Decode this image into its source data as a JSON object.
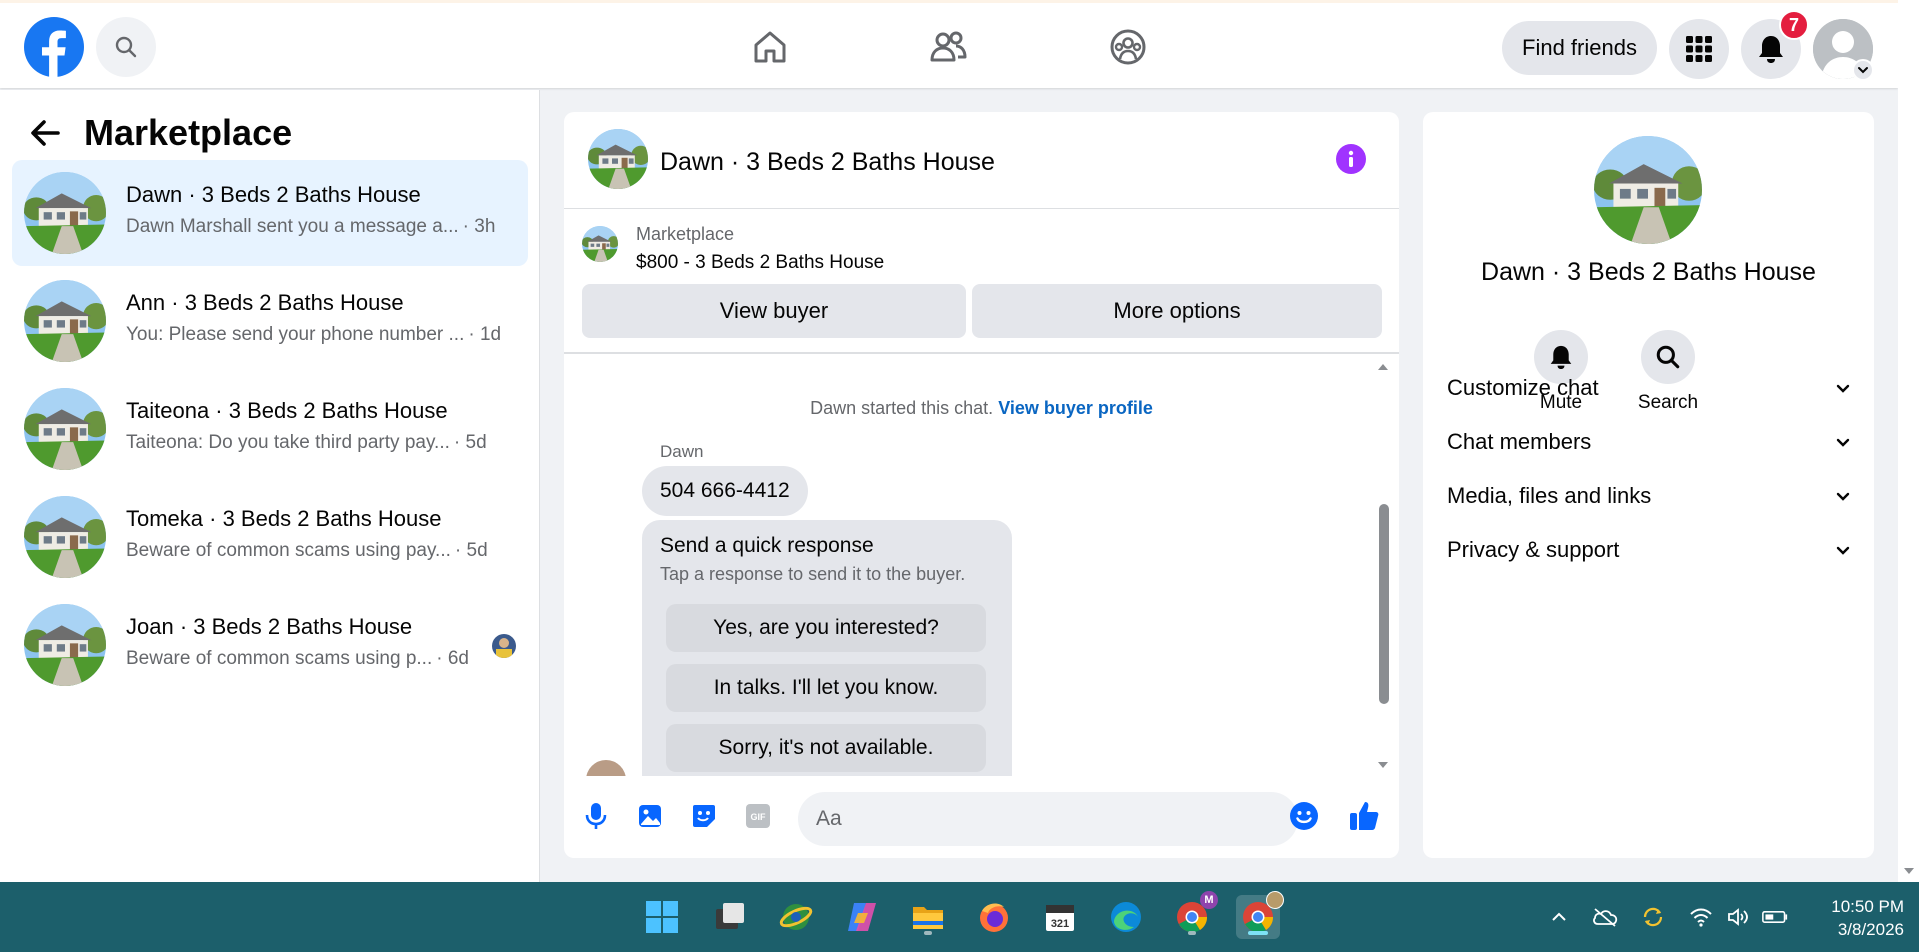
{
  "topbar": {
    "find_friends_label": "Find friends",
    "notifications_count": "7",
    "icons": [
      "facebook-logo",
      "search-icon",
      "home-icon",
      "friends-icon",
      "groups-icon",
      "menu-grid-icon",
      "bell-icon",
      "avatar"
    ]
  },
  "sidebar": {
    "title": "Marketplace",
    "conversations": [
      {
        "title": "Dawn · 3 Beds 2 Baths House",
        "snippet": "Dawn Marshall sent you a message a...",
        "time": "· 3h",
        "active": true
      },
      {
        "title": "Ann · 3 Beds 2 Baths House",
        "snippet": "You: Please send your phone number ...",
        "time": "· 1d",
        "active": false
      },
      {
        "title": "Taiteona · 3 Beds 2 Baths House",
        "snippet": "Taiteona: Do you take third party pay...",
        "time": "· 5d",
        "active": false
      },
      {
        "title": "Tomeka · 3 Beds 2 Baths House",
        "snippet": "Beware of common scams using pay...",
        "time": "· 5d",
        "active": false
      },
      {
        "title": "Joan · 3 Beds 2 Baths House",
        "snippet": "Beware of common scams using p...",
        "time": "· 6d",
        "active": false
      }
    ]
  },
  "chat": {
    "title": "Dawn · 3 Beds 2 Baths House",
    "listing_label": "Marketplace",
    "listing_price": "$800 - 3 Beds 2 Baths House",
    "view_buyer_label": "View buyer",
    "more_options_label": "More options",
    "started_text": "Dawn started this chat.",
    "view_profile_link": "View buyer profile",
    "sender_name": "Dawn",
    "message": "504 666-4412",
    "quick_response": {
      "title": "Send a quick response",
      "subtitle": "Tap a response to send it to the buyer.",
      "options": [
        "Yes, are you interested?",
        "In talks. I'll let you know.",
        "Sorry, it's not available."
      ]
    },
    "composer_placeholder": "Aa"
  },
  "info_panel": {
    "name": "Dawn · 3 Beds 2 Baths House",
    "mute_label": "Mute",
    "search_label": "Search",
    "sections": [
      "Customize chat",
      "Chat members",
      "Media, files and links",
      "Privacy & support"
    ]
  },
  "taskbar": {
    "time": "10:50 PM",
    "date": "3/8/2026",
    "apps": [
      "windows-start",
      "task-view",
      "globe-app",
      "copilot",
      "file-explorer",
      "firefox",
      "calendar-app",
      "edge",
      "chrome-profile-m",
      "chrome-active"
    ]
  },
  "colors": {
    "facebook_blue": "#1877f2",
    "active_conversation": "#e7f3ff",
    "info_purple": "#a033ff",
    "link_blue": "#0a66c2",
    "badge_red": "#e41e3f",
    "taskbar": "#1c5f6b"
  }
}
